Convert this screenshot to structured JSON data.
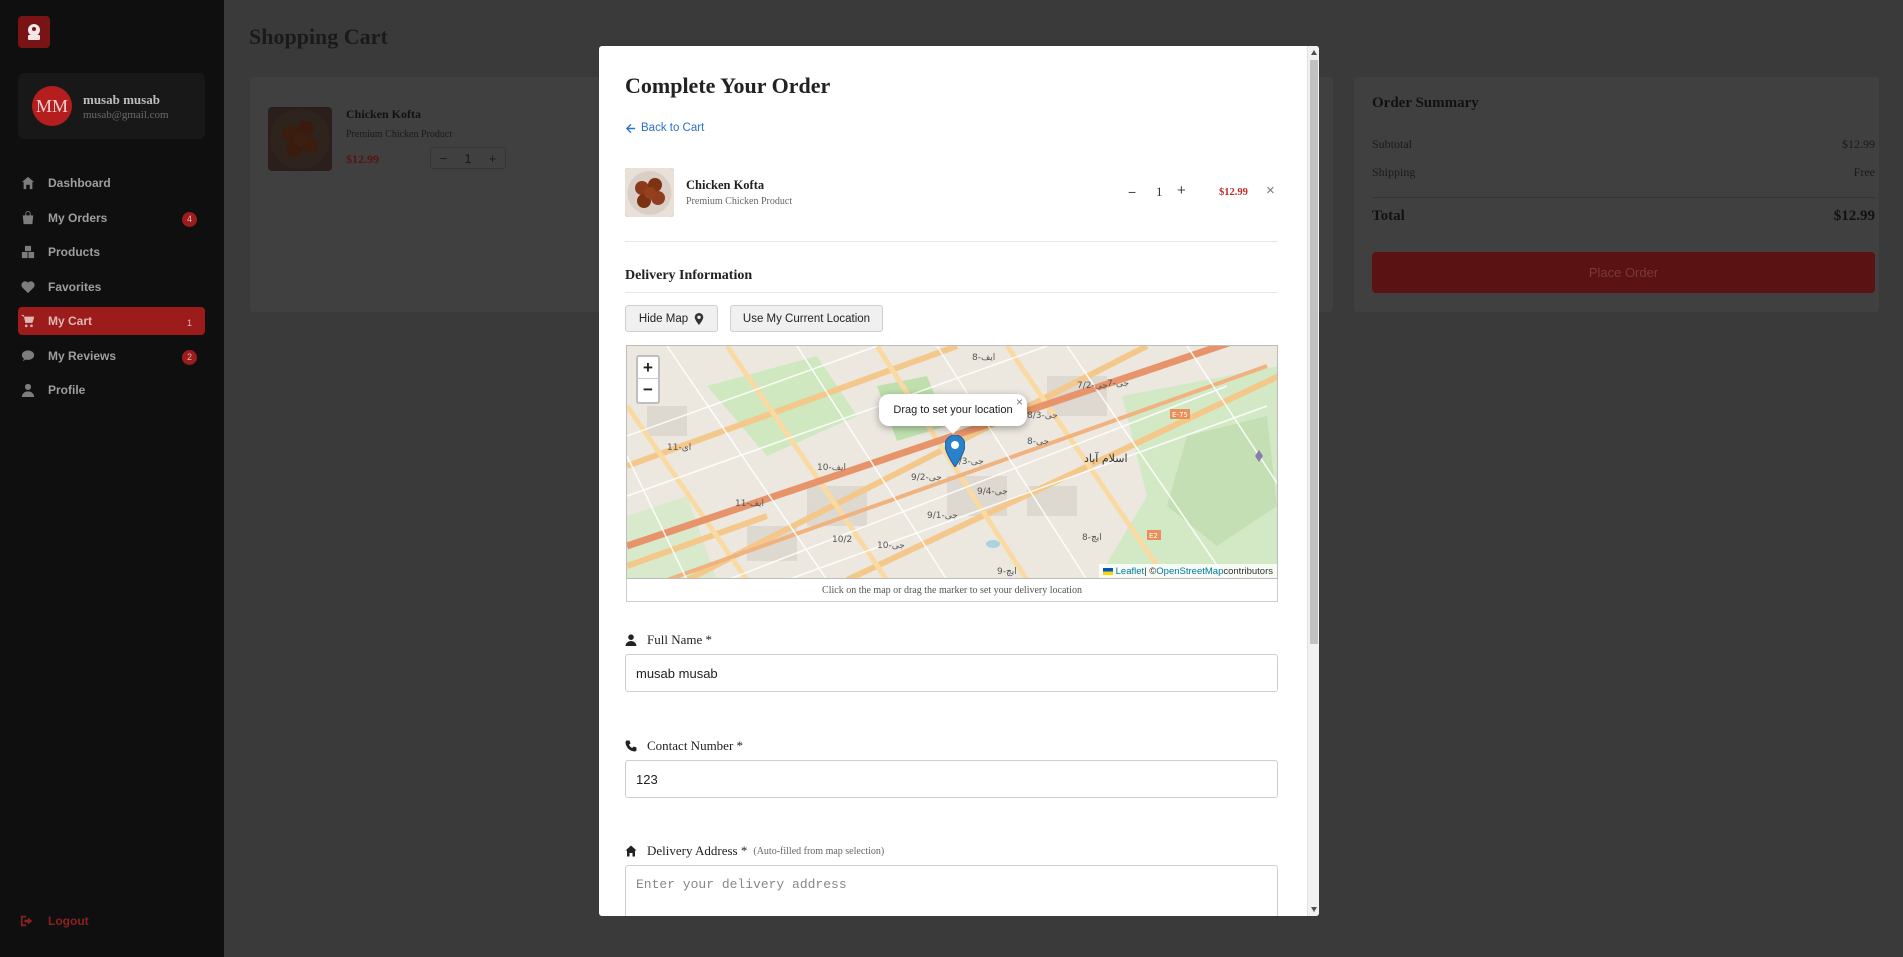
{
  "sidebar": {
    "user": {
      "initials": "MM",
      "name": "musab musab",
      "email": "musab@gmail.com"
    },
    "items": [
      {
        "label": "Dashboard",
        "icon": "home-icon",
        "badge": null,
        "active": false
      },
      {
        "label": "My Orders",
        "icon": "shopping-bag-icon",
        "badge": "4",
        "active": false
      },
      {
        "label": "Products",
        "icon": "boxes-icon",
        "badge": null,
        "active": false
      },
      {
        "label": "Favorites",
        "icon": "heart-icon",
        "badge": null,
        "active": false
      },
      {
        "label": "My Cart",
        "icon": "cart-icon",
        "badge": "1",
        "active": true
      },
      {
        "label": "My Reviews",
        "icon": "comment-icon",
        "badge": "2",
        "active": false
      },
      {
        "label": "Profile",
        "icon": "user-icon",
        "badge": null,
        "active": false
      }
    ],
    "logout": "Logout"
  },
  "main": {
    "title": "Shopping Cart",
    "cart_item": {
      "name": "Chicken Kofta",
      "subtitle": "Premium Chicken Product",
      "price": "$12.99",
      "qty": "1"
    },
    "summary": {
      "title": "Order Summary",
      "subtotal_label": "Subtotal",
      "subtotal": "$12.99",
      "shipping_label": "Shipping",
      "shipping": "Free",
      "total_label": "Total",
      "total": "$12.99",
      "place_order": "Place Order"
    }
  },
  "modal": {
    "title": "Complete Your Order",
    "back": "Back to Cart",
    "item": {
      "name": "Chicken Kofta",
      "subtitle": "Premium Chicken Product",
      "minus": "−",
      "qty": "1",
      "plus": "+",
      "price": "$12.99",
      "remove": "×"
    },
    "delivery_title": "Delivery Information",
    "hide_map": "Hide Map",
    "use_location": "Use My Current Location",
    "map": {
      "zoom_in": "+",
      "zoom_out": "−",
      "popup": "Drag to set your location",
      "popup_close": "×",
      "attribution_leaflet": "Leaflet",
      "attribution_sep": " | © ",
      "attribution_osm": "OpenStreetMap",
      "attribution_tail": " contributors",
      "labels": [
        "ایف-8",
        "جی-7",
        "جی-8/3",
        "ای-11",
        "ایف-10",
        "جی-9/3",
        "جی-9/2",
        "جی-9/4",
        "ایف-11",
        "جی-9/1",
        "جی-10",
        "جی-8",
        "اسلام آباد",
        "ایچ-8",
        "ایچ-9",
        "E-75",
        "E2",
        "10/2",
        "جی-7/2"
      ]
    },
    "map_caption": "Click on the map or drag the marker to set your delivery location",
    "full_name": {
      "label": "Full Name *",
      "value": "musab musab"
    },
    "contact": {
      "label": "Contact Number *",
      "value": "123"
    },
    "address": {
      "label": "Delivery Address *",
      "hint": "(Auto-filled from map selection)",
      "placeholder": "Enter your delivery address"
    }
  },
  "colors": {
    "accent": "#b51e1e",
    "link": "#2b70c9",
    "price": "#c0292b"
  }
}
